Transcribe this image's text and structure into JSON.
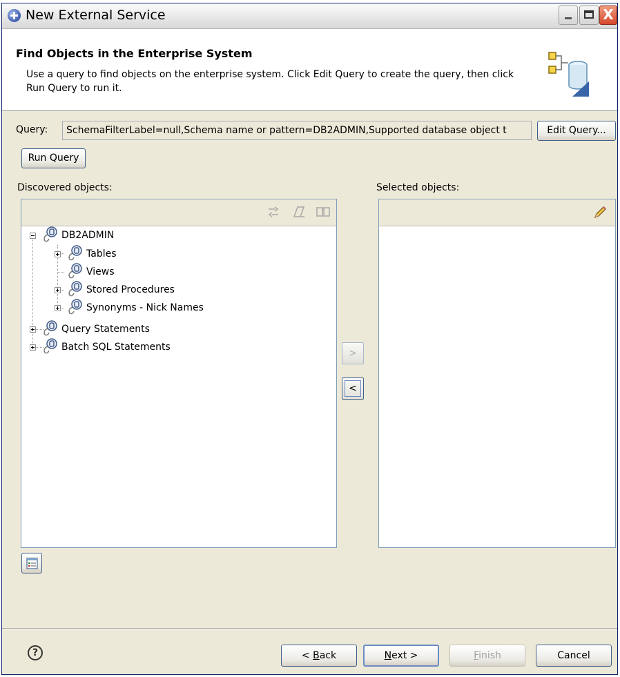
{
  "window": {
    "title": "New External Service",
    "controls": {
      "minimize": "_",
      "maximize": "□",
      "close": "X"
    }
  },
  "header": {
    "title": "Find Objects in the Enterprise System",
    "description": "Use a query to find objects on the enterprise system.  Click Edit Query to create the query, then click Run Query to run it.",
    "icon": "database-wizard-icon"
  },
  "query": {
    "label": "Query:",
    "value": "SchemaFilterLabel=null,Schema name or pattern=DB2ADMIN,Supported database object t",
    "edit_button": "Edit Query...",
    "run_button": "Run Query"
  },
  "discovered": {
    "label": "Discovered objects:",
    "toolbar_icons": [
      "filter-icon",
      "edit-icon",
      "book-icon"
    ],
    "tree": [
      {
        "label": "DB2ADMIN",
        "expanded": true,
        "children": [
          {
            "label": "Tables",
            "expandable": true
          },
          {
            "label": "Views",
            "expandable": false
          },
          {
            "label": "Stored Procedures",
            "expandable": true
          },
          {
            "label": "Synonyms - Nick Names",
            "expandable": true
          }
        ]
      },
      {
        "label": "Query Statements",
        "expandable": true
      },
      {
        "label": "Batch SQL Statements",
        "expandable": true
      }
    ]
  },
  "selected": {
    "label": "Selected objects:",
    "toolbar_icons": [
      "pencil-icon"
    ]
  },
  "move": {
    "add": ">",
    "remove": "<"
  },
  "footer": {
    "back_prefix": "< ",
    "back_key": "B",
    "back_rest": "ack",
    "next_key": "N",
    "next_rest": "ext >",
    "finish_key": "F",
    "finish_rest": "inish",
    "cancel": "Cancel",
    "help": "?"
  }
}
